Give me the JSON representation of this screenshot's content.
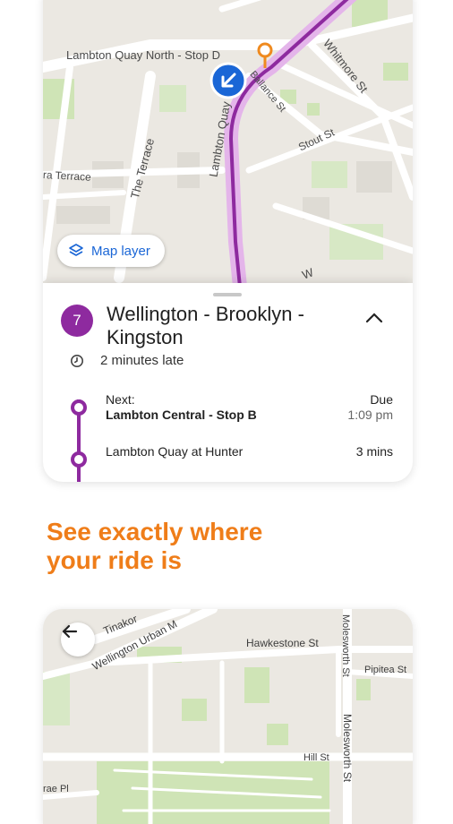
{
  "map_top": {
    "streets": {
      "lambton_quay_north": "Lambton Quay North - Stop D",
      "whitmore": "Whitmore St",
      "ballance": "Ballance St",
      "stout": "Stout St",
      "the_terrace": "The Terrace",
      "lambton_quay": "Lambton Quay",
      "ara_terrace": "ra Terrace",
      "w": "W"
    },
    "map_layer_label": "Map layer"
  },
  "route": {
    "number": "7",
    "title": "Wellington - Brooklyn - Kingston",
    "status": "2 minutes late",
    "route_color": "#8e2a9f"
  },
  "stops": [
    {
      "prefix": "Next:",
      "name": "Lambton Central - Stop B",
      "eta": "Due",
      "time": "1:09 pm"
    },
    {
      "prefix": "",
      "name": "Lambton Quay at Hunter",
      "eta": "3 mins",
      "time": ""
    }
  ],
  "headline": {
    "line1": "See exactly where",
    "line2": "your ride is",
    "color": "#ef7d19"
  },
  "map_bottom": {
    "streets": {
      "tinakori": "Tinakor",
      "wellington_urban": "Wellington Urban M",
      "hawkestone": "Hawkestone St",
      "pipitea": "Pipitea St",
      "molesworth": "Molesworth St",
      "molesworth_top": "Molesworth St",
      "hill": "Hill St",
      "rae": "rae Pl"
    }
  }
}
